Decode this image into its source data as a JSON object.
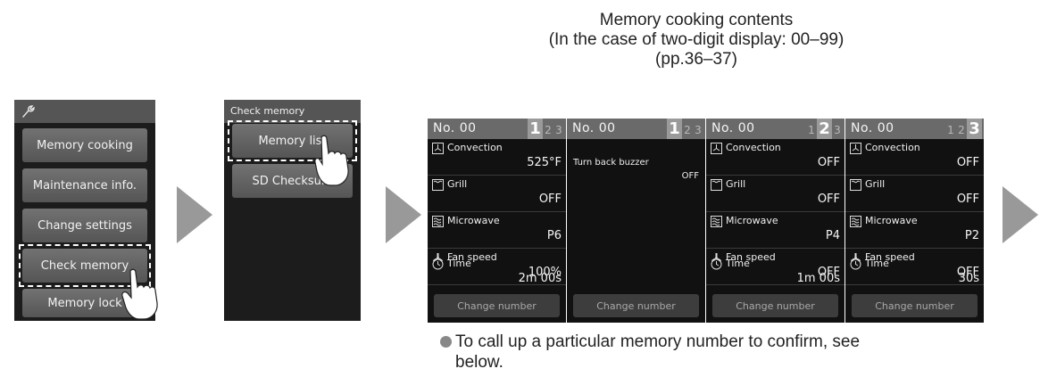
{
  "header": {
    "line1": "Memory cooking contents",
    "line2": "(In the case of two-digit display:  00–99)",
    "line3": "(pp.36–37)"
  },
  "main_menu": {
    "icon": "wrench-icon",
    "items": [
      "Memory cooking",
      "Maintenance info.",
      "Change settings",
      "Check memory",
      "Memory lock"
    ],
    "highlighted": "Check memory"
  },
  "check_menu": {
    "title": "Check memory",
    "items": [
      "Memory list",
      "SD Checksum"
    ],
    "highlighted": "Memory list"
  },
  "panels": [
    {
      "no": "No. 00",
      "tabs": [
        "1",
        "2",
        "3"
      ],
      "active_tab": "1",
      "rows": [
        {
          "icon": "convection-icon",
          "label": "Convection",
          "value": "525°F"
        },
        {
          "icon": "grill-icon",
          "label": "Grill",
          "value": "OFF"
        },
        {
          "icon": "microwave-icon",
          "label": "Microwave",
          "value": "P6"
        },
        {
          "icon": "fan-icon",
          "label": "Fan speed",
          "value": "100%"
        },
        {
          "icon": "clock-icon",
          "label": "Time",
          "value": "2m 00s"
        }
      ],
      "button": "Change number"
    },
    {
      "no": "No. 00",
      "tabs": [
        "1",
        "2",
        "3"
      ],
      "active_tab": "1",
      "buzzer_label": "Turn back buzzer",
      "buzzer_value": "OFF",
      "button": "Change number"
    },
    {
      "no": "No. 00",
      "tabs": [
        "1",
        "2",
        "3"
      ],
      "active_tab": "2",
      "rows": [
        {
          "icon": "convection-icon",
          "label": "Convection",
          "value": "OFF"
        },
        {
          "icon": "grill-icon",
          "label": "Grill",
          "value": "OFF"
        },
        {
          "icon": "microwave-icon",
          "label": "Microwave",
          "value": "P4"
        },
        {
          "icon": "fan-icon",
          "label": "Fan speed",
          "value": "OFF"
        },
        {
          "icon": "clock-icon",
          "label": "Time",
          "value": "1m 00s"
        }
      ],
      "button": "Change number"
    },
    {
      "no": "No. 00",
      "tabs": [
        "1",
        "2",
        "3"
      ],
      "active_tab": "3",
      "rows": [
        {
          "icon": "convection-icon",
          "label": "Convection",
          "value": "OFF"
        },
        {
          "icon": "grill-icon",
          "label": "Grill",
          "value": "OFF"
        },
        {
          "icon": "microwave-icon",
          "label": "Microwave",
          "value": "P2"
        },
        {
          "icon": "fan-icon",
          "label": "Fan speed",
          "value": "OFF"
        },
        {
          "icon": "clock-icon",
          "label": "Time",
          "value": "30s"
        }
      ],
      "button": "Change number"
    }
  ],
  "note": {
    "line1": "To call up a particular memory number to confirm, see",
    "line2": "below."
  },
  "colors": {
    "screen_bg": "#1c1c1c",
    "button_gradient_top": "#727272",
    "button_gradient_bottom": "#555555",
    "active_tab": "#9a9a9a",
    "flow_arrow": "#999999"
  }
}
